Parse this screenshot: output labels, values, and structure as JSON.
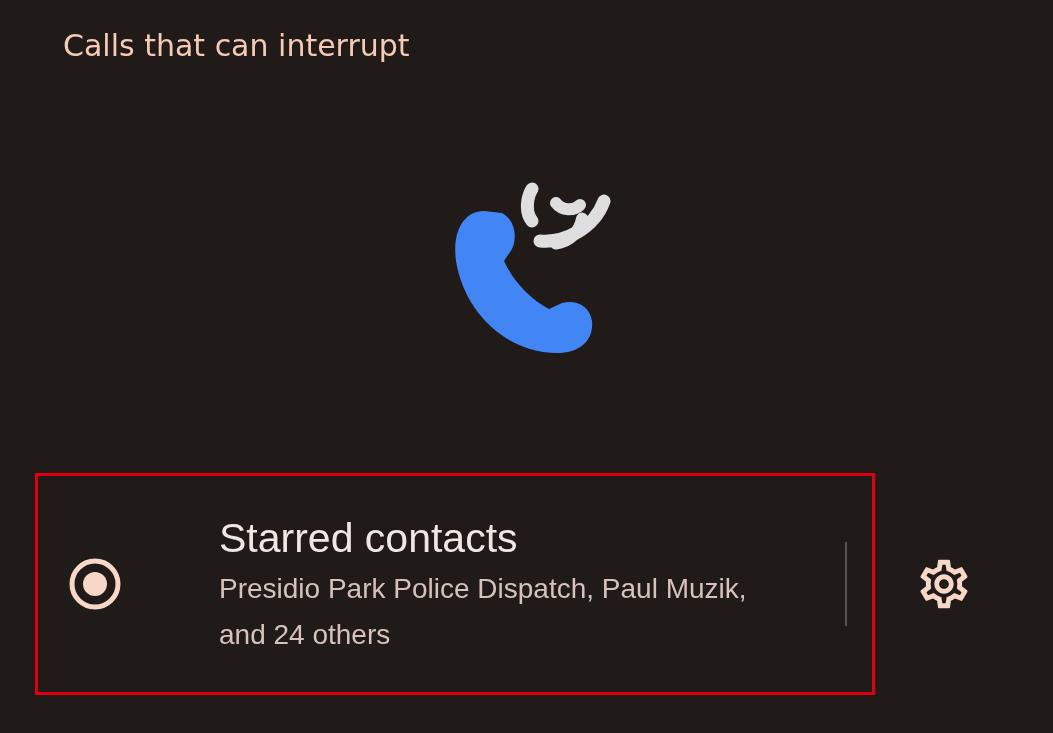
{
  "title": "Calls that can interrupt",
  "option": {
    "title": "Starred contacts",
    "summary": "Presidio Park Police Dispatch, Paul Muzik, and 24 others",
    "selected": true,
    "highlighted": true
  }
}
